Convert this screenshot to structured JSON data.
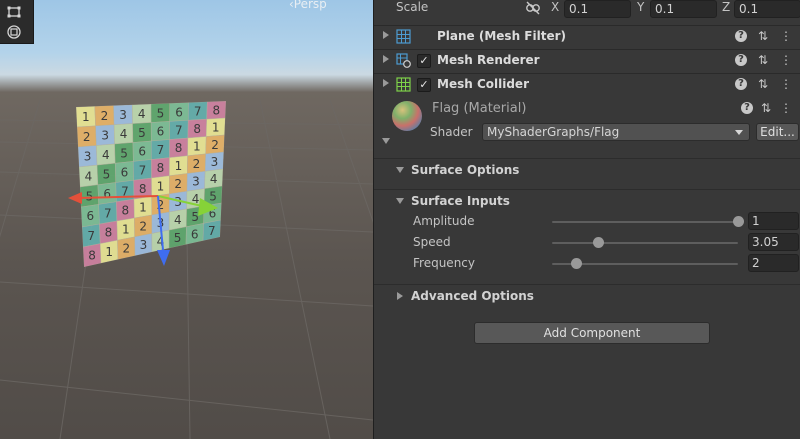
{
  "scene": {
    "persp_label": "‹Persp",
    "tools": [
      {
        "icon": "rect-tool-icon"
      },
      {
        "icon": "transform-tool-icon"
      }
    ],
    "flag_grid": [
      [
        "1",
        "2",
        "3",
        "4",
        "5",
        "6",
        "7",
        "8"
      ],
      [
        "2",
        "3",
        "4",
        "5",
        "6",
        "7",
        "8",
        "1"
      ],
      [
        "3",
        "4",
        "5",
        "6",
        "7",
        "8",
        "1",
        "2"
      ],
      [
        "4",
        "5",
        "6",
        "7",
        "8",
        "1",
        "2",
        "3"
      ],
      [
        "5",
        "6",
        "7",
        "8",
        "1",
        "2",
        "3",
        "4"
      ],
      [
        "6",
        "7",
        "8",
        "1",
        "2",
        "3",
        "4",
        "5"
      ],
      [
        "7",
        "8",
        "1",
        "2",
        "3",
        "4",
        "5",
        "6"
      ],
      [
        "8",
        "1",
        "2",
        "3",
        "4",
        "5",
        "6",
        "7"
      ]
    ]
  },
  "transform": {
    "scale_label": "Scale",
    "x_label": "X",
    "x_value": "0.1",
    "y_label": "Y",
    "y_value": "0.1",
    "z_label": "Z",
    "z_value": "0.1"
  },
  "components": [
    {
      "name": "Plane (Mesh Filter)",
      "icon": "mesh-filter-icon",
      "checkbox": false
    },
    {
      "name": "Mesh Renderer",
      "icon": "mesh-renderer-icon",
      "checkbox": true
    },
    {
      "name": "Mesh Collider",
      "icon": "mesh-collider-icon",
      "checkbox": true
    }
  ],
  "material": {
    "title": "Flag (Material)",
    "shader_label": "Shader",
    "shader_value": "MyShaderGraphs/Flag",
    "edit_label": "Edit..."
  },
  "sections": {
    "surface_options": "Surface Options",
    "surface_inputs": "Surface Inputs",
    "advanced_options": "Advanced Options"
  },
  "properties": [
    {
      "label": "Amplitude",
      "value": "1",
      "slider_fraction": 1.0
    },
    {
      "label": "Speed",
      "value": "3.05",
      "slider_fraction": 0.25
    },
    {
      "label": "Frequency",
      "value": "2",
      "slider_fraction": 0.13
    }
  ],
  "add_component_label": "Add Component",
  "colors": {
    "inspector_bg": "#383838",
    "field_bg": "#2a2a2a",
    "gizmo_x": "#e4503a",
    "gizmo_y": "#86d238",
    "gizmo_z": "#3f6df0"
  }
}
